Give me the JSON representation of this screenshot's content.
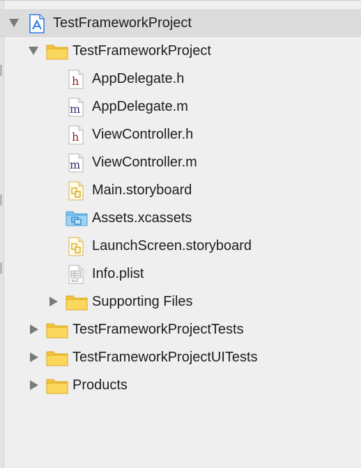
{
  "project": {
    "name": "TestFrameworkProject",
    "icon": "xcode-project-icon",
    "expanded": true
  },
  "group_main": {
    "name": "TestFrameworkProject",
    "icon": "folder-icon",
    "expanded": true,
    "files": [
      {
        "name": "AppDelegate.h",
        "icon": "header-file-icon",
        "glyph": "h"
      },
      {
        "name": "AppDelegate.m",
        "icon": "objc-source-file-icon",
        "glyph": "m"
      },
      {
        "name": "ViewController.h",
        "icon": "header-file-icon",
        "glyph": "h"
      },
      {
        "name": "ViewController.m",
        "icon": "objc-source-file-icon",
        "glyph": "m"
      },
      {
        "name": "Main.storyboard",
        "icon": "storyboard-file-icon"
      },
      {
        "name": "Assets.xcassets",
        "icon": "asset-catalog-icon"
      },
      {
        "name": "LaunchScreen.storyboard",
        "icon": "storyboard-file-icon"
      },
      {
        "name": "Info.plist",
        "icon": "plist-file-icon",
        "glyph": "PLIST"
      }
    ],
    "subgroup": {
      "name": "Supporting Files",
      "icon": "folder-icon",
      "expanded": false
    }
  },
  "groups_collapsed": [
    {
      "name": "TestFrameworkProjectTests",
      "icon": "folder-icon",
      "expanded": false
    },
    {
      "name": "TestFrameworkProjectUITests",
      "icon": "folder-icon",
      "expanded": false
    },
    {
      "name": "Products",
      "icon": "folder-icon",
      "expanded": false
    }
  ],
  "colors": {
    "background": "#efefef",
    "selected_row": "#dcdcdc",
    "folder_yellow": "#f7c843",
    "header_glyph": "#8b1a1a",
    "source_glyph": "#3b2a6e",
    "asset_blue": "#5aaee0",
    "project_blue": "#2f7be6"
  }
}
